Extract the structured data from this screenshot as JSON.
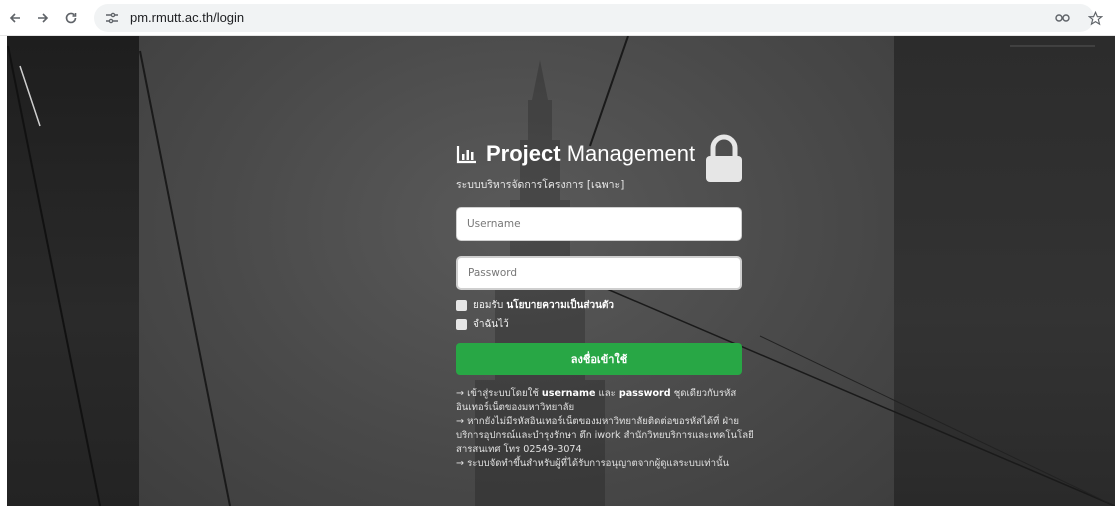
{
  "browser": {
    "url": "pm.rmutt.ac.th/login",
    "icons": [
      "back-arrow-icon",
      "forward-arrow-icon",
      "reload-icon",
      "site-info-icon",
      "key-icon",
      "star-icon"
    ]
  },
  "login": {
    "brand_bold": "Project",
    "brand_rest": " Management",
    "subtitle": "ระบบบริหารจัดการโครงการ [เฉพาะ]",
    "username_placeholder": "Username",
    "password_placeholder": "Password",
    "accept_prefix": "ยอมรับ ",
    "accept_policy": "นโยบายความเป็นส่วนตัว",
    "remember_label": "จำฉันไว้",
    "submit_label": "ลงชื่อเข้าใช้",
    "info1_prefix": "→ เข้าสู่ระบบโดยใช้ ",
    "info1_username": "username",
    "info1_mid": " และ ",
    "info1_password": "password",
    "info1_suffix": " ชุดเดียวกับรหัสอินเทอร์เน็ตของมหาวิทยาลัย",
    "info2": "→ หากยังไม่มีรหัสอินเทอร์เน็ตของมหาวิทยาลัยติดต่อขอรหัสได้ที่ ฝ่ายบริการอุปกรณ์และบำรุงรักษา ตึก iwork สำนักวิทยบริการและเทคโนโลยีสารสนเทศ โทร 02549-3074",
    "info3": "→ ระบบจัดทำขึ้นสำหรับผู้ที่ได้รับการอนุญาตจากผู้ดูแลระบบเท่านั้น"
  },
  "colors": {
    "accent_green": "#28a745",
    "page_dark": "#4a4a4a"
  }
}
